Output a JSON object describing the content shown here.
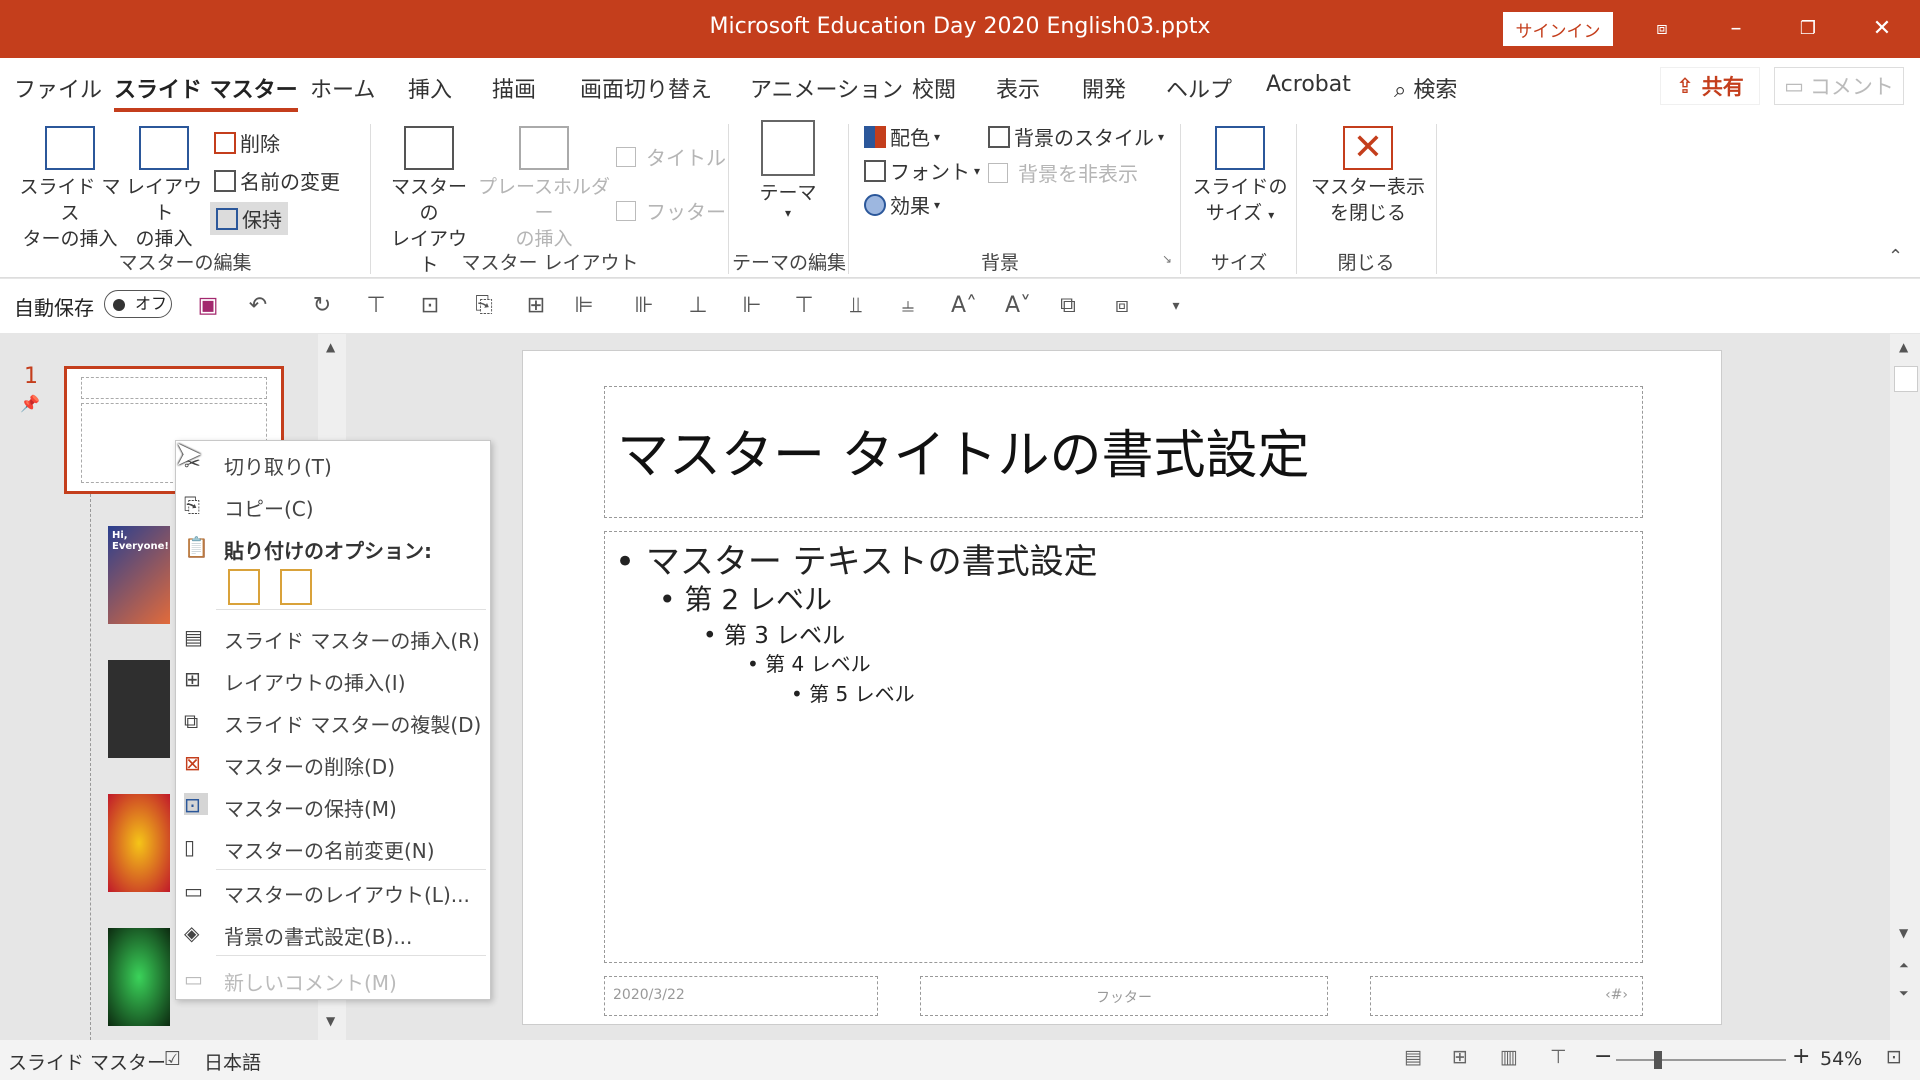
{
  "window": {
    "title": "Microsoft Education Day 2020 English03.pptx",
    "signin": "サインイン"
  },
  "tabs": [
    "ファイル",
    "スライド マスター",
    "ホーム",
    "挿入",
    "描画",
    "画面切り替え",
    "アニメーション",
    "校閲",
    "表示",
    "開発",
    "ヘルプ",
    "Acrobat"
  ],
  "search": "検索",
  "share": "共有",
  "comment": "コメント",
  "ribbon": {
    "insert_master": [
      "スライド マス",
      "ターの挿入"
    ],
    "insert_layout": [
      "レイアウト",
      "の挿入"
    ],
    "delete": "削除",
    "rename": "名前の変更",
    "preserve": "保持",
    "group_edit_master": "マスターの編集",
    "master_layout": [
      "マスターの",
      "レイアウト"
    ],
    "insert_placeholder": [
      "プレースホルダー",
      "の挿入"
    ],
    "title_chk": "タイトル",
    "footer_chk": "フッター",
    "group_master_layout": "マスター レイアウト",
    "theme": "テーマ",
    "group_edit_theme": "テーマの編集",
    "colors": "配色",
    "fonts": "フォント",
    "effects": "効果",
    "bg_styles": "背景のスタイル",
    "hide_bg": "背景を非表示",
    "group_background": "背景",
    "slide_size": [
      "スライドの",
      "サイズ"
    ],
    "group_size": "サイズ",
    "close_master": [
      "マスター表示",
      "を閉じる"
    ],
    "group_close": "閉じる"
  },
  "qat": {
    "autosave": "自動保存",
    "toggle": "オフ"
  },
  "thumb": {
    "number": "1",
    "thumb2_text": "Hi, Everyone!"
  },
  "slide": {
    "title": "マスター タイトルの書式設定",
    "l1": "マスター テキストの書式設定",
    "l2": "第 2 レベル",
    "l3": "第 3 レベル",
    "l4": "第 4 レベル",
    "l5": "第 5 レベル",
    "date": "2020/3/22",
    "footer": "フッター",
    "num": "‹#›"
  },
  "context_menu": {
    "cut": "切り取り(T)",
    "copy": "コピー(C)",
    "paste_options": "貼り付けのオプション:",
    "insert_master": "スライド マスターの挿入(R)",
    "insert_layout": "レイアウトの挿入(I)",
    "duplicate_master": "スライド マスターの複製(D)",
    "delete_master": "マスターの削除(D)",
    "preserve_master": "マスターの保持(M)",
    "rename_master": "マスターの名前変更(N)",
    "master_layout": "マスターのレイアウト(L)...",
    "format_bg": "背景の書式設定(B)...",
    "new_comment": "新しいコメント(M)"
  },
  "status": {
    "view": "スライド マスター",
    "lang": "日本語",
    "zoom": "54%"
  },
  "colors": {
    "accent": "#c43e1c"
  }
}
